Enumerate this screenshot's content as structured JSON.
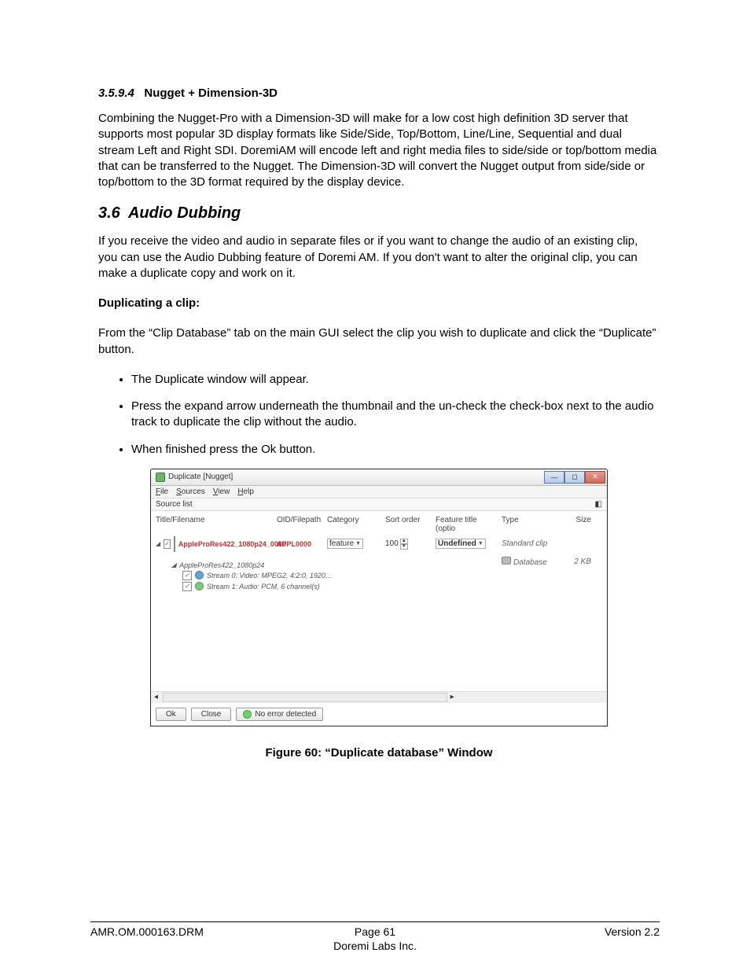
{
  "section_3594": {
    "num": "3.5.9.4",
    "title": "Nugget + Dimension-3D",
    "body": "Combining the Nugget-Pro with a Dimension-3D will make for a low cost high definition 3D server that supports most popular 3D display formats like Side/Side, Top/Bottom, Line/Line, Sequential and dual stream Left and Right SDI. DoremiAM will encode left and right media files to side/side or top/bottom media that can be transferred to the Nugget. The Dimension-3D will convert the Nugget output from side/side or top/bottom to the 3D format required by the display device."
  },
  "section_36": {
    "num": "3.6",
    "title": "Audio Dubbing",
    "intro": "If you receive the video and audio in separate files or if you want to change the audio of an existing clip, you can use the Audio Dubbing feature of Doremi AM. If you don't want to alter the original clip, you can make a duplicate copy and work on it.",
    "dup_heading": "Duplicating a clip:",
    "dup_intro": "From the “Clip Database” tab on the main GUI select the clip you wish to duplicate and click the “Duplicate” button.",
    "bullets": [
      "The Duplicate window will appear.",
      "Press the expand arrow underneath the thumbnail and the un-check the check-box next to the audio track to duplicate the clip without the audio.",
      "When finished press the Ok button."
    ]
  },
  "window": {
    "title": "Duplicate [Nugget]",
    "menu": [
      "File",
      "Sources",
      "View",
      "Help"
    ],
    "panel_label": "Source list",
    "headers": {
      "title": "Title/Filename",
      "oid": "OID/Filepath",
      "category": "Category",
      "sort": "Sort order",
      "feature": "Feature title (optio",
      "type": "Type",
      "size": "Size"
    },
    "row": {
      "title": "AppleProRes422_1080p24_0000",
      "oid": "APPL0000",
      "category": "feature",
      "sort": "100",
      "feature": "Undefined",
      "type": "Standard clip",
      "loc": "Database",
      "size": "2 KB"
    },
    "tree": {
      "parent": "AppleProRes422_1080p24",
      "video": "Stream 0: Video: MPEG2, 4:2:0, 1920…",
      "audio": "Stream 1: Audio: PCM, 6 channel(s)"
    },
    "buttons": {
      "ok": "Ok",
      "close": "Close",
      "err": "No error detected"
    }
  },
  "caption": "Figure 60: “Duplicate database” Window",
  "footer": {
    "left": "AMR.OM.000163.DRM",
    "center": "Page 61",
    "company": "Doremi Labs Inc.",
    "right": "Version 2.2"
  }
}
